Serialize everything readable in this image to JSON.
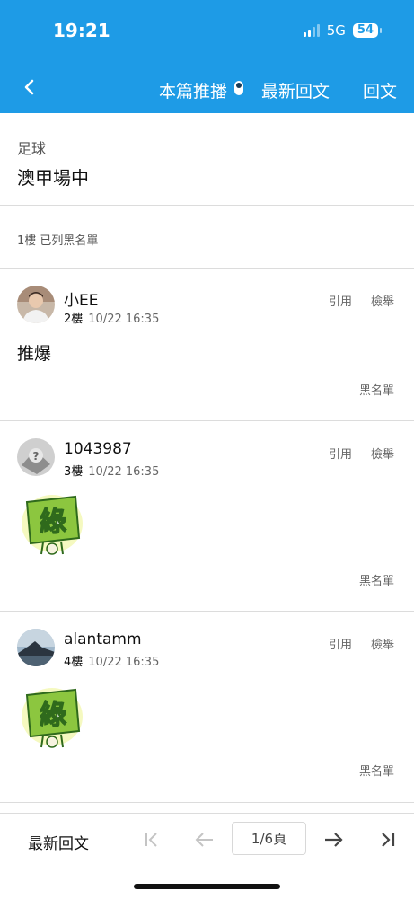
{
  "status": {
    "time": "19:21",
    "network": "5G",
    "battery": "54"
  },
  "nav": {
    "push_toggle": "本篇推播",
    "latest": "最新回文",
    "reply": "回文"
  },
  "thread": {
    "board": "足球",
    "title": "澳甲場中"
  },
  "blocked_notice": "1樓 已列黑名單",
  "posts": [
    {
      "user": "小EE",
      "floor": "2樓",
      "time": "10/22 16:35",
      "quote": "引用",
      "report": "檢舉",
      "text": "推爆",
      "blacklist": "黑名單"
    },
    {
      "user": "1043987",
      "floor": "3樓",
      "time": "10/22 16:35",
      "quote": "引用",
      "report": "檢舉",
      "sticker": "綠",
      "blacklist": "黑名單"
    },
    {
      "user": "alantamm",
      "floor": "4樓",
      "time": "10/22 16:35",
      "quote": "引用",
      "report": "檢舉",
      "sticker": "綠",
      "blacklist": "黑名單"
    }
  ],
  "bottom": {
    "latest": "最新回文",
    "page": "1/6頁"
  },
  "colors": {
    "header": "#1e9be6",
    "sticker_green": "#8cc63f"
  }
}
